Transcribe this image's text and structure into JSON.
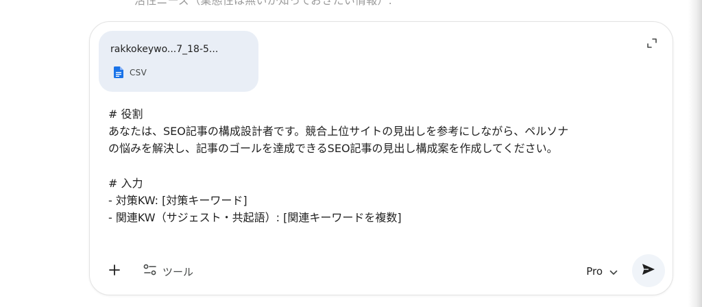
{
  "background_text": "活性ニーズ（業態性は無いか知っておきたい情報）:",
  "composer": {
    "attachment": {
      "file_name": "rakkokeywo...7_18-5...",
      "file_type": "CSV",
      "icon": "google-doc-icon",
      "icon_color": "#1a73e8"
    },
    "expand_icon": "expand-icon",
    "prompt_text": "# 役割\nあなたは、SEO記事の構成設計者です。競合上位サイトの見出しを参考にしながら、ペルソナ\nの悩みを解決し、記事のゴールを達成できるSEO記事の見出し構成案を作成してください。\n\n# 入力\n- 対策KW: [対策キーワード]\n- 関連KW（サジェスト・共起語）: [関連キーワードを複数]",
    "toolbar": {
      "add_icon": "plus-icon",
      "tools_icon": "tools-sliders-icon",
      "tools_label": "ツール"
    },
    "model_selector": {
      "label": "Pro",
      "icon": "chevron-down-icon"
    },
    "send_icon": "send-icon"
  }
}
